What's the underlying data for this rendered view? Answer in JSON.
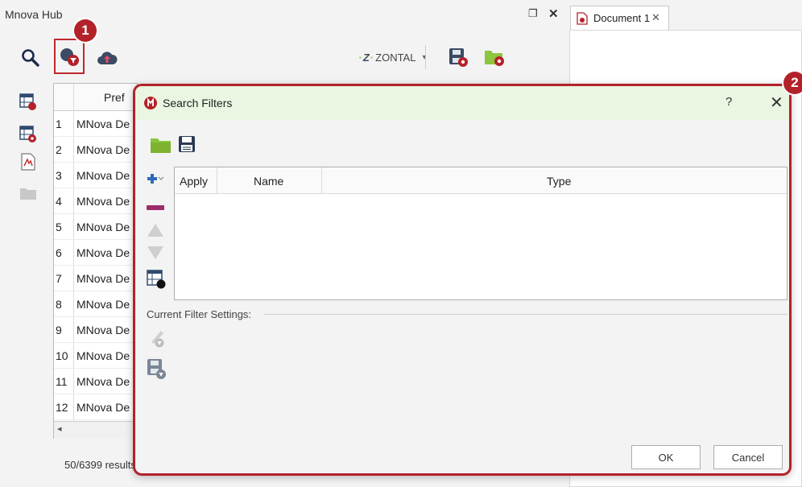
{
  "hub": {
    "title": "Mnova Hub",
    "toolbar": {
      "zontal_label": "ZONTAL"
    },
    "badges": {
      "first": "1",
      "second": "2"
    },
    "table": {
      "column_header": "Pref",
      "rows": [
        {
          "num": "1",
          "name": "MNova De"
        },
        {
          "num": "2",
          "name": "MNova De"
        },
        {
          "num": "3",
          "name": "MNova De"
        },
        {
          "num": "4",
          "name": "MNova De"
        },
        {
          "num": "5",
          "name": "MNova De"
        },
        {
          "num": "6",
          "name": "MNova De"
        },
        {
          "num": "7",
          "name": "MNova De"
        },
        {
          "num": "8",
          "name": "MNova De"
        },
        {
          "num": "9",
          "name": "MNova De"
        },
        {
          "num": "10",
          "name": "MNova De"
        },
        {
          "num": "11",
          "name": "MNova De"
        },
        {
          "num": "12",
          "name": "MNova De"
        }
      ]
    },
    "results_count": "50/6399 results"
  },
  "document": {
    "tab_label": "Document 1"
  },
  "dialog": {
    "title": "Search Filters",
    "help": "?",
    "table_headers": {
      "apply": "Apply",
      "name": "Name",
      "type": "Type"
    },
    "settings_label": "Current Filter Settings:",
    "ok_label": "OK",
    "cancel_label": "Cancel"
  },
  "colors": {
    "accent_red": "#b3222a",
    "dialog_title_bg": "#eaf6e1",
    "folder_green": "#8cc63f",
    "add_blue": "#2f6ab8",
    "remove_purple": "#9b2c6a"
  }
}
